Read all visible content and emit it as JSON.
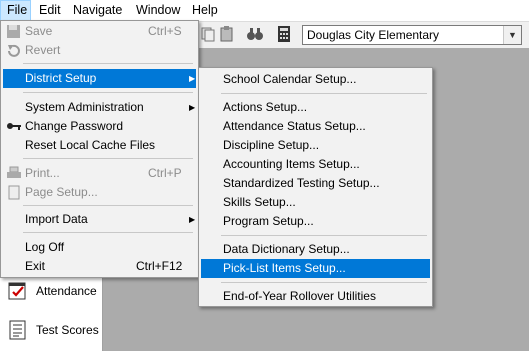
{
  "menubar": {
    "items": [
      {
        "label": "File"
      },
      {
        "label": "Edit"
      },
      {
        "label": "Navigate"
      },
      {
        "label": "Window"
      },
      {
        "label": "Help"
      }
    ]
  },
  "toolbar": {
    "school_select_value": "Douglas City Elementary"
  },
  "left_panel": {
    "items": [
      {
        "label": "Attendance",
        "icon": "attendance-icon"
      },
      {
        "label": "Test Scores",
        "icon": "test-scores-icon"
      }
    ]
  },
  "file_menu": {
    "items": [
      {
        "label": "Save",
        "shortcut": "Ctrl+S",
        "enabled": false,
        "icon": "save-icon"
      },
      {
        "label": "Revert",
        "shortcut": "",
        "enabled": false,
        "icon": "revert-icon"
      },
      {
        "label": "District Setup",
        "submenu": true,
        "highlighted": true
      },
      {
        "label": "System Administration",
        "submenu": true
      },
      {
        "label": "Change Password",
        "icon": "keys-icon"
      },
      {
        "label": "Reset Local Cache Files"
      },
      {
        "label": "Print...",
        "shortcut": "Ctrl+P",
        "enabled": false,
        "icon": "print-icon"
      },
      {
        "label": "Page Setup...",
        "enabled": false,
        "icon": "page-setup-icon"
      },
      {
        "label": "Import Data",
        "submenu": true
      },
      {
        "label": "Log Off"
      },
      {
        "label": "Exit",
        "shortcut": "Ctrl+F12"
      }
    ]
  },
  "district_submenu": {
    "items": [
      {
        "label": "School Calendar Setup..."
      },
      {
        "label": "Actions Setup..."
      },
      {
        "label": "Attendance Status Setup..."
      },
      {
        "label": "Discipline Setup..."
      },
      {
        "label": "Accounting Items Setup..."
      },
      {
        "label": "Standardized Testing Setup..."
      },
      {
        "label": "Skills Setup..."
      },
      {
        "label": "Program Setup..."
      },
      {
        "label": "Data Dictionary Setup..."
      },
      {
        "label": "Pick-List Items Setup...",
        "highlighted": true
      },
      {
        "label": "End-of-Year Rollover Utilities"
      }
    ]
  },
  "colors": {
    "highlight": "#0078d7",
    "menubar_active": "#cce8ff",
    "workspace": "#ababab"
  }
}
